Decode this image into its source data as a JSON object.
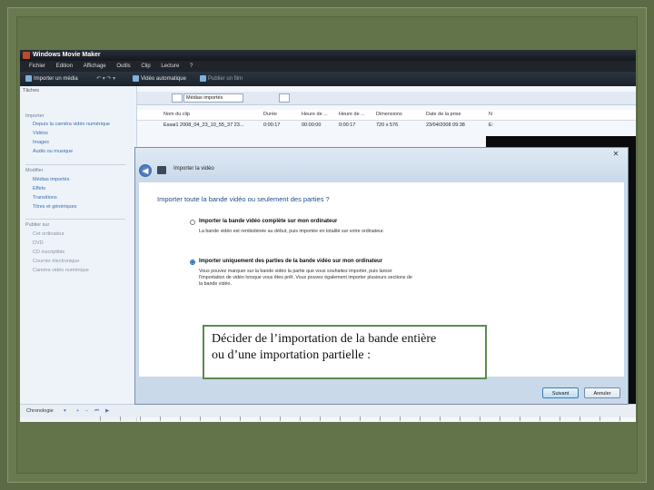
{
  "app": {
    "title": "Windows Movie Maker",
    "menu": [
      "Fichier",
      "Edition",
      "Affichage",
      "Outils",
      "Clip",
      "Lecture",
      "?"
    ],
    "toolbar": {
      "import": "Importer un média",
      "auto": "Vidéo automatique",
      "publish": "Publier un film"
    }
  },
  "tasks": {
    "header": "Tâches",
    "groups": [
      {
        "title": "Importer",
        "items": [
          "Depuis la caméra vidéo numérique",
          "Vidéos",
          "Images",
          "Audio ou musique"
        ]
      },
      {
        "title": "Modifier",
        "items": [
          "Médias importés",
          "Effets",
          "Transitions",
          "Titres et génériques"
        ]
      },
      {
        "title": "Publier sur",
        "items": [
          "Cet ordinateur",
          "DVD",
          "CD inscriptible",
          "Courrier électronique",
          "Caméra vidéo numérique"
        ]
      }
    ]
  },
  "browser": {
    "combo": "Médias importés"
  },
  "columns": [
    "Nom du clip",
    "Durée",
    "Heure de ...",
    "Heure de ...",
    "Dimensions",
    "Date de la prise",
    "N"
  ],
  "clip_row": [
    "Essai1 2008_04_23_10_55_37 23...",
    "0:00:17",
    "00:00:00",
    "0:00:17",
    "720 x 576",
    "23/04/2008 09:38",
    "E:"
  ],
  "timeline": {
    "label": "Chronologie"
  },
  "dialog": {
    "title": "Importer la vidéo",
    "heading": "Importer toute la bande vidéo ou seulement des parties ?",
    "option1": {
      "title": "Importer la bande vidéo complète sur mon ordinateur",
      "desc": "La bande vidéo est rembobinée au début, puis importée en totalité sur votre ordinateur."
    },
    "option2": {
      "title": "Importer uniquement des parties de la bande vidéo sur mon ordinateur",
      "desc": "Vous pouvez marquer sur la bande vidéo la partie que vous souhaitez importer, puis lancer l'importation de vidéo lorsque vous êtes prêt. Vous pouvez également importer plusieurs sections de la bande vidéo."
    },
    "next": "Suivant",
    "cancel": "Annuler"
  },
  "callout": {
    "line1": "Décider de l’importation de la bande entière",
    "line2": "ou d’une importation partielle :"
  }
}
